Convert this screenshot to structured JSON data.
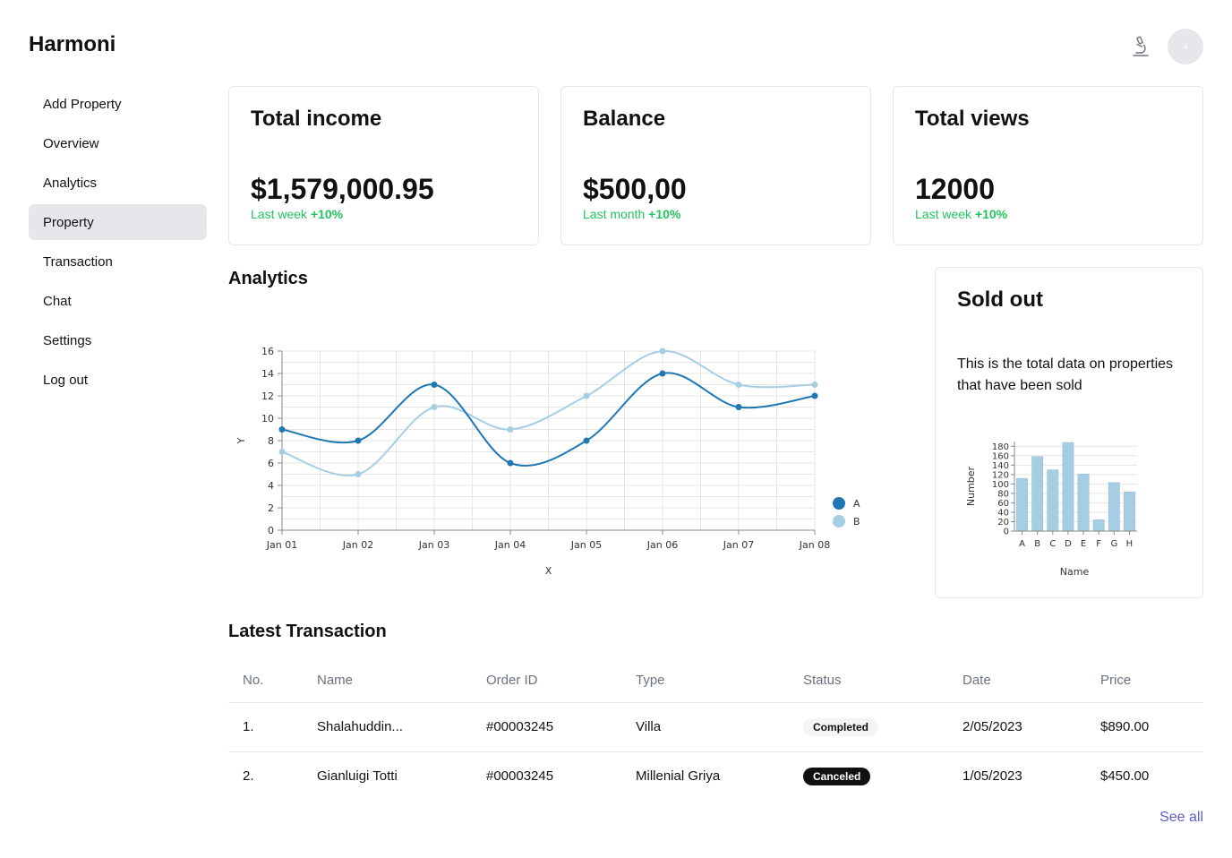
{
  "app": {
    "brand": "Harmoni"
  },
  "header": {
    "lab_icon": "microscope-icon"
  },
  "sidebar": {
    "items": [
      {
        "label": "Add Property"
      },
      {
        "label": "Overview"
      },
      {
        "label": "Analytics"
      },
      {
        "label": "Property",
        "active": true
      },
      {
        "label": "Transaction"
      },
      {
        "label": "Chat"
      },
      {
        "label": "Settings"
      },
      {
        "label": "Log out"
      }
    ]
  },
  "cards": [
    {
      "title": "Total income",
      "value": "$1,579,000.95",
      "period": "Last week",
      "change": "+10%"
    },
    {
      "title": "Balance",
      "value": "$500,00",
      "period": "Last month",
      "change": "+10%"
    },
    {
      "title": "Total views",
      "value": "12000",
      "period": "Last week",
      "change": "+10%"
    }
  ],
  "analytics": {
    "title": "Analytics"
  },
  "sold": {
    "title": "Sold out",
    "description": "This is the total data on properties that have been sold"
  },
  "transactions": {
    "title": "Latest Transaction",
    "columns": [
      "No.",
      "Name",
      "Order ID",
      "Type",
      "Status",
      "Date",
      "Price"
    ],
    "rows": [
      {
        "no": "1.",
        "name": "Shalahuddin...",
        "order_id": "#00003245",
        "type": "Villa",
        "status": "Completed",
        "date": "2/05/2023",
        "price": "$890.00"
      },
      {
        "no": "2.",
        "name": "Gianluigi Totti",
        "order_id": "#00003245",
        "type": "Millenial Griya",
        "status": "Canceled",
        "date": "1/05/2023",
        "price": "$450.00"
      }
    ],
    "see_all": "See all"
  },
  "colors": {
    "accent_dark": "#1f77b4",
    "accent_light": "#a6cee3",
    "positive": "#22c55e",
    "link": "#5b5fc7"
  },
  "chart_data": [
    {
      "type": "line",
      "x": [
        "Jan 01",
        "Jan 02",
        "Jan 03",
        "Jan 04",
        "Jan 05",
        "Jan 06",
        "Jan 07",
        "Jan 08"
      ],
      "xlabel": "X",
      "ylabel": "Y",
      "ylim": [
        0,
        16
      ],
      "yticks": [
        0,
        2,
        4,
        6,
        8,
        10,
        12,
        14,
        16
      ],
      "grid": true,
      "legend": "right",
      "series": [
        {
          "name": "A",
          "color": "#1f77b4",
          "values": [
            9,
            8,
            13,
            6,
            8,
            14,
            11,
            12
          ]
        },
        {
          "name": "B",
          "color": "#a6cee3",
          "values": [
            7,
            5,
            11,
            9,
            12,
            16,
            13,
            13
          ]
        }
      ]
    },
    {
      "type": "bar",
      "categories": [
        "A",
        "B",
        "C",
        "D",
        "E",
        "F",
        "G",
        "H"
      ],
      "values": [
        112,
        158,
        130,
        188,
        121,
        24,
        103,
        83
      ],
      "xlabel": "Name",
      "ylabel": "Number",
      "ylim": [
        0,
        190
      ],
      "yticks": [
        0,
        20,
        40,
        60,
        80,
        100,
        120,
        140,
        160,
        180
      ],
      "grid": true,
      "color": "#a6cee3"
    }
  ]
}
